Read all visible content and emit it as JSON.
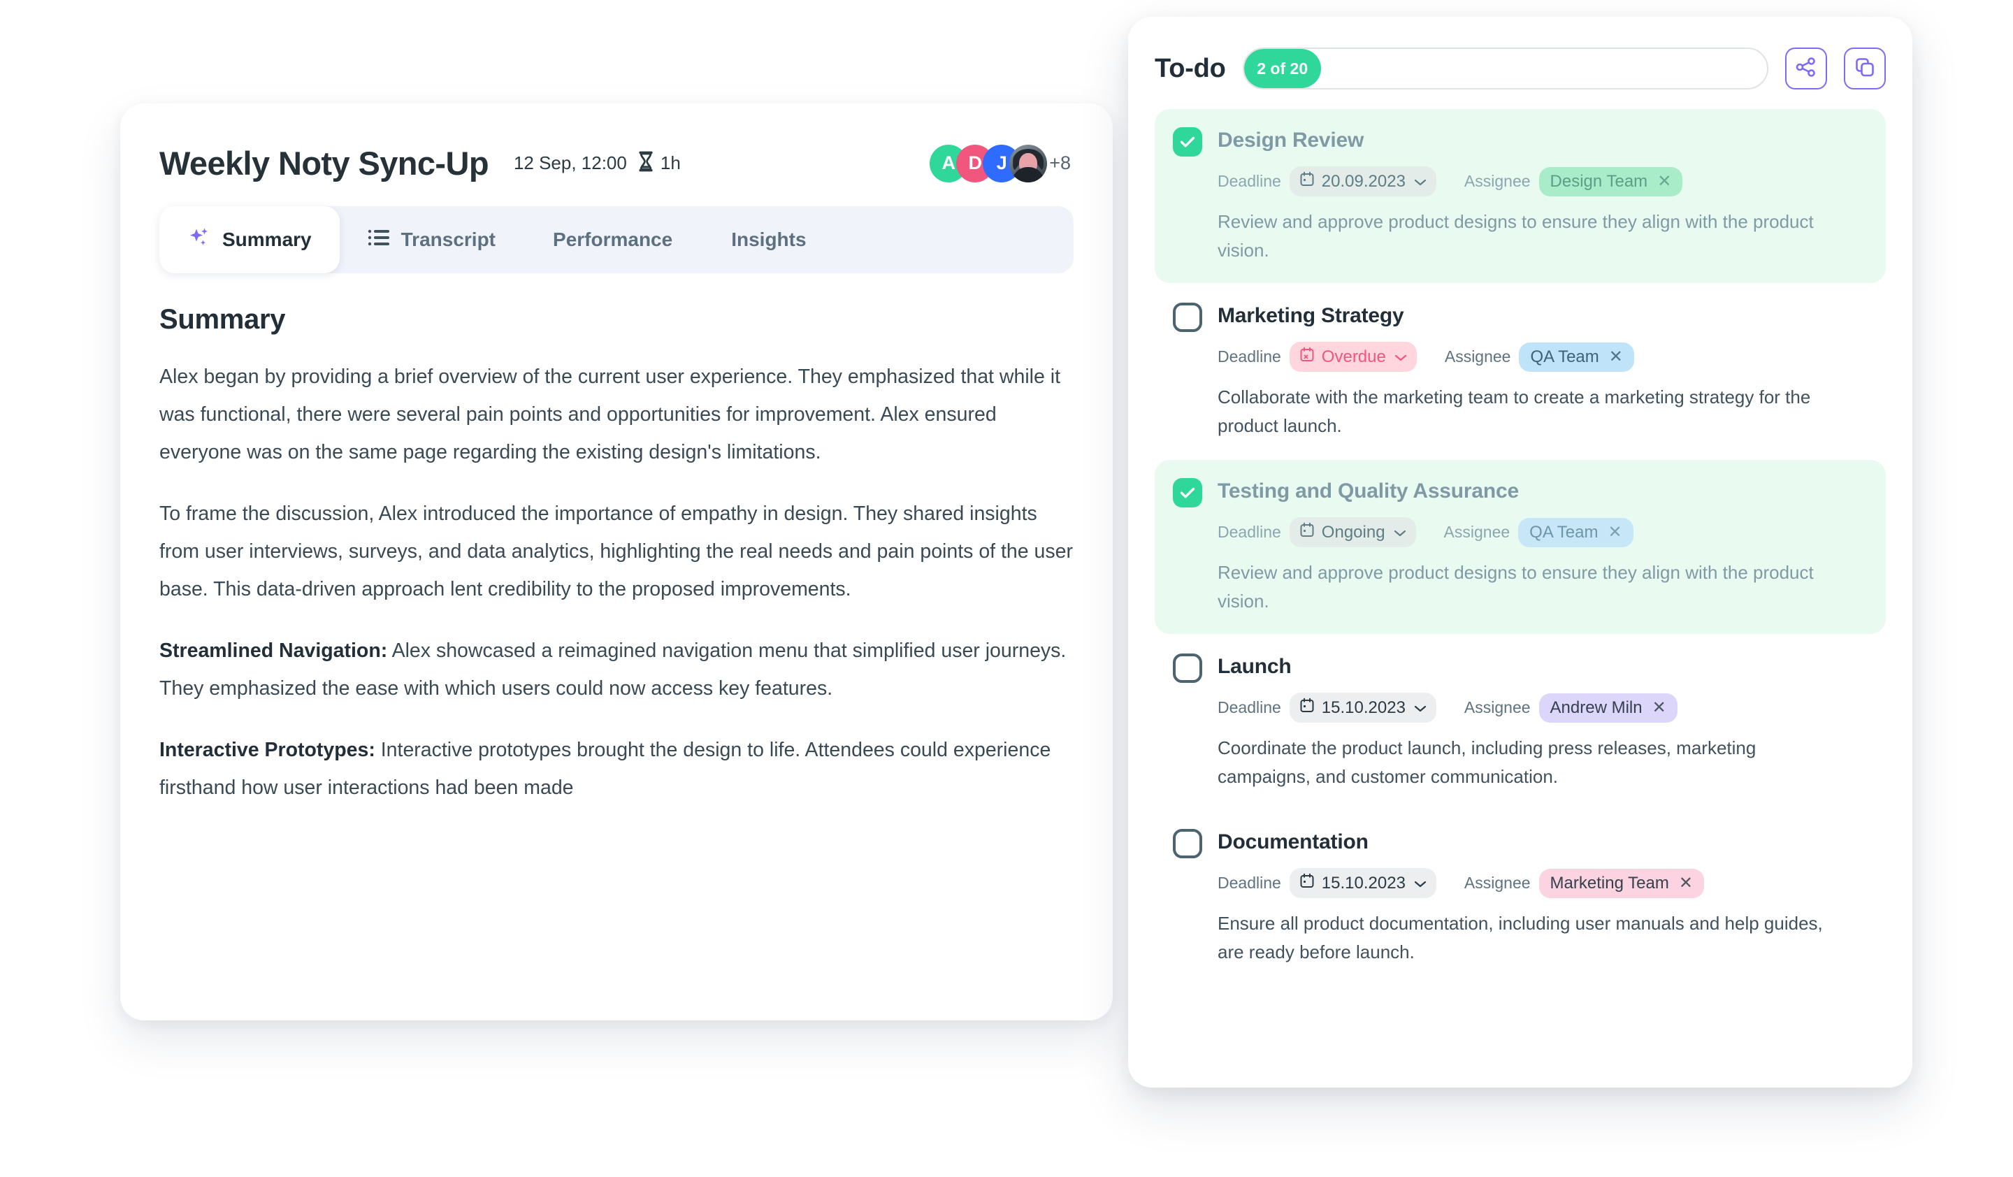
{
  "meeting": {
    "title": "Weekly Noty Sync-Up",
    "date": "12 Sep, 12:00",
    "duration": "1h",
    "avatars": [
      {
        "initial": "A",
        "color": "#2fd79b"
      },
      {
        "initial": "D",
        "color": "#f0567e"
      },
      {
        "initial": "J",
        "color": "#2f6bff"
      }
    ],
    "avatar_overflow": "+8",
    "tabs": [
      {
        "label": "Summary",
        "icon": "sparkle-icon",
        "active": true
      },
      {
        "label": "Transcript",
        "icon": "list-icon",
        "active": false
      },
      {
        "label": "Performance",
        "icon": "",
        "active": false
      },
      {
        "label": "Insights",
        "icon": "",
        "active": false
      }
    ],
    "summary": {
      "heading": "Summary",
      "paragraphs": [
        {
          "bold": "",
          "text": "Alex began by providing a brief overview of the current user experience. They emphasized that while it was functional, there were several pain points and opportunities for improvement. Alex ensured everyone was on the same page regarding the existing design's limitations."
        },
        {
          "bold": "",
          "text": "To frame the discussion, Alex introduced the importance of empathy in design. They shared insights from user interviews, surveys, and data analytics, highlighting the real needs and pain points of the user base. This data-driven approach lent credibility to the proposed improvements."
        },
        {
          "bold": "Streamlined Navigation:",
          "text": " Alex showcased a reimagined navigation menu that simplified user journeys. They emphasized the ease with which users could now access key features."
        },
        {
          "bold": "Interactive Prototypes:",
          "text": " Interactive prototypes brought the design to life. Attendees could experience firsthand how user interactions had been made"
        }
      ]
    }
  },
  "todo": {
    "title": "To-do",
    "progress_label": "2 of 20",
    "progress_done": 2,
    "progress_total": 20,
    "share_icon": "share-icon",
    "copy_icon": "copy-icon",
    "deadline_label": "Deadline",
    "assignee_label": "Assignee",
    "items": [
      {
        "name": "Design Review",
        "done": true,
        "deadline": "20.09.2023",
        "deadline_state": "normal",
        "assignee": "Design Team",
        "assignee_bg": "#a8ecc9",
        "assignee_fg": "#3f6f5d",
        "description": "Review and approve product designs to ensure they align with the product vision."
      },
      {
        "name": "Marketing Strategy",
        "done": false,
        "deadline": "Overdue",
        "deadline_state": "overdue",
        "assignee": "QA Team",
        "assignee_bg": "#bfe4fa",
        "assignee_fg": "#3b6a86",
        "description": "Collaborate with the marketing team to create a marketing strategy for the product launch."
      },
      {
        "name": "Testing and Quality Assurance",
        "done": true,
        "deadline": "Ongoing",
        "deadline_state": "normal",
        "assignee": "QA Team",
        "assignee_bg": "#bfe4fa",
        "assignee_fg": "#6694a8",
        "description": "Review and approve product designs to ensure they align with the product vision."
      },
      {
        "name": "Launch",
        "done": false,
        "deadline": "15.10.2023",
        "deadline_state": "normal",
        "assignee": "Andrew Miln",
        "assignee_bg": "#ddd6fb",
        "assignee_fg": "#35414c",
        "description": "Coordinate the product launch, including press releases, marketing campaigns, and customer communication."
      },
      {
        "name": "Documentation",
        "done": false,
        "deadline": "15.10.2023",
        "deadline_state": "normal",
        "assignee": "Marketing Team",
        "assignee_bg": "#fcd3e1",
        "assignee_fg": "#35414c",
        "description": "Ensure all product documentation, including user manuals and help guides, are ready before launch."
      }
    ]
  },
  "colors": {
    "accent_purple": "#7c6cf5",
    "success_green": "#2fd79b",
    "overdue_pink": "#f0567e",
    "text_dark": "#222f38",
    "text_muted": "#5f7280"
  }
}
